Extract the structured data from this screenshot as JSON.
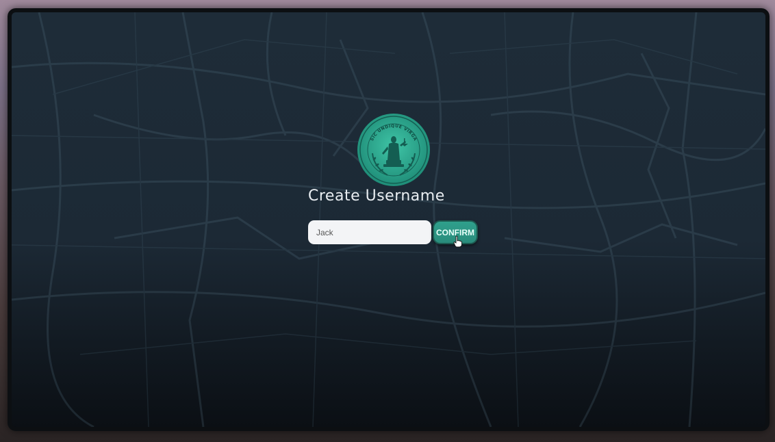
{
  "login": {
    "title": "Create Username",
    "username_value": "Jack",
    "confirm_label": "CONFIRM"
  },
  "seal": {
    "motto": "SIC UNDIQUE VIRGA",
    "icon": "justice-seal-icon"
  },
  "colors": {
    "accent": "#2fa08c",
    "panel": "#1e2c38",
    "title_text": "#e9eef2"
  }
}
